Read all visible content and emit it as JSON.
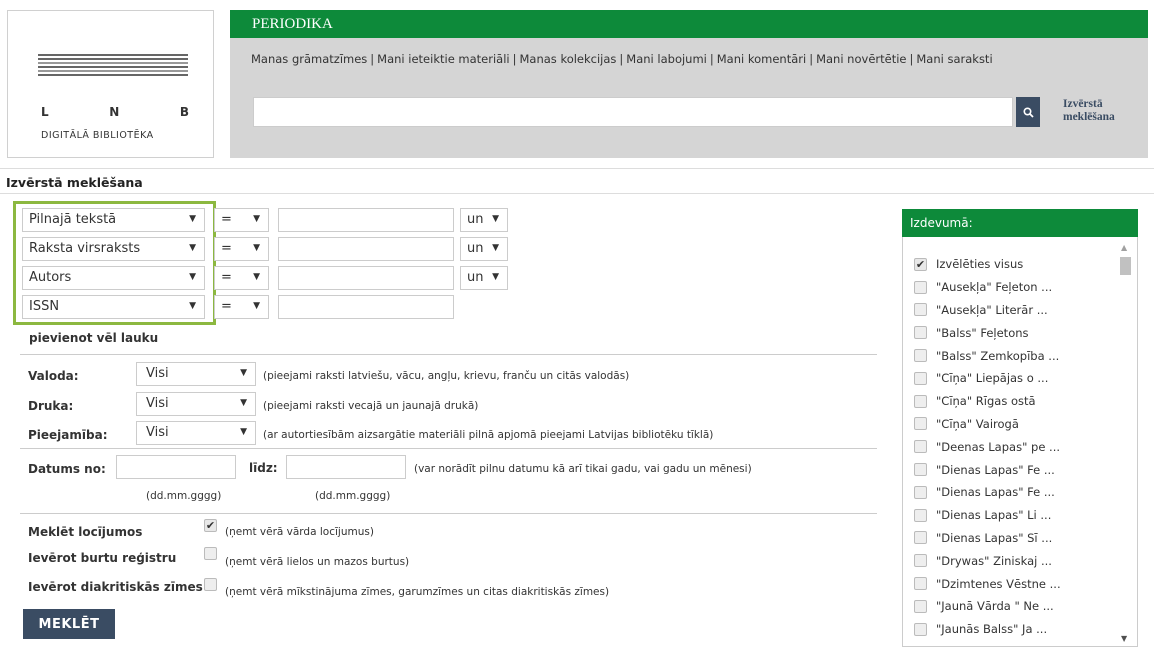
{
  "logo": {
    "letters": [
      "L",
      "N",
      "B"
    ],
    "subtitle": "DIGITĀLĀ BIBLIOTĒKA"
  },
  "header": {
    "title": "PERIODIKA",
    "links": [
      "Manas grāmatzīmes",
      "Mani ieteiktie materiāli",
      "Manas kolekcijas",
      "Mani labojumi",
      "Mani komentāri",
      "Mani novērtētie",
      "Mani saraksti"
    ],
    "search_icon": "search-icon",
    "advanced_line1": "Izvērstā",
    "advanced_line2": "meklēšana"
  },
  "page_title": "Izvērstā meklēšana",
  "fields": [
    {
      "field": "Pilnajā tekstā",
      "op": "=",
      "value": "",
      "conj": "un"
    },
    {
      "field": "Raksta virsraksts",
      "op": "=",
      "value": "",
      "conj": "un"
    },
    {
      "field": "Autors",
      "op": "=",
      "value": "",
      "conj": "un"
    },
    {
      "field": "ISSN",
      "op": "=",
      "value": "",
      "conj": ""
    }
  ],
  "add_field": "pievienot vēl lauku",
  "filters": [
    {
      "label": "Valoda:",
      "value": "Visi",
      "note": "(pieejami raksti latviešu, vācu, angļu, krievu, franču un citās valodās)"
    },
    {
      "label": "Druka:",
      "value": "Visi",
      "note": "(pieejami raksti vecajā un jaunajā drukā)"
    },
    {
      "label": "Pieejamība:",
      "value": "Visi",
      "note": "(ar autortiesībām aizsargātie materiāli pilnā apjomā pieejami Latvijas bibliotēku tīklā)"
    }
  ],
  "dates": {
    "from_label": "Datums no:",
    "to_label": "līdz:",
    "note": "(var norādīt pilnu datumu kā arī tikai gadu, vai gadu un mēnesi)",
    "format_from": "(dd.mm.gggg)",
    "format_to": "(dd.mm.gggg)"
  },
  "options": [
    {
      "label": "Meklēt locījumos",
      "checked": true,
      "note": "(ņemt vērā vārda locījumus)"
    },
    {
      "label": "Ievērot burtu reģistru",
      "checked": false,
      "note": "(ņemt vērā lielos un mazos burtus)"
    },
    {
      "label": "Ievērot diakritiskās zīmes",
      "checked": false,
      "note": "(ņemt vērā mīkstinājuma zīmes, garumzīmes un citas diakritiskās zīmes)"
    }
  ],
  "submit_label": "MEKLĒT",
  "publications": {
    "title": "Izdevumā:",
    "items": [
      {
        "label": "Izvēlēties visus",
        "checked": true
      },
      {
        "label": "\"Ausekļa\" Feļeton ...",
        "checked": false
      },
      {
        "label": "\"Ausekļa\" Literār ...",
        "checked": false
      },
      {
        "label": "\"Balss\" Feļetons",
        "checked": false
      },
      {
        "label": "\"Balss\" Zemkopība ...",
        "checked": false
      },
      {
        "label": "\"Cīņa\" Liepājas o ...",
        "checked": false
      },
      {
        "label": "\"Cīņa\" Rīgas ostā",
        "checked": false
      },
      {
        "label": "\"Cīņa\" Vairogā",
        "checked": false
      },
      {
        "label": "\"Deenas Lapas\" pe ...",
        "checked": false
      },
      {
        "label": "\"Dienas Lapas\" Fe ...",
        "checked": false
      },
      {
        "label": "\"Dienas Lapas\" Fe ...",
        "checked": false
      },
      {
        "label": "\"Dienas Lapas\" Li ...",
        "checked": false
      },
      {
        "label": "\"Dienas Lapas\" Sī ...",
        "checked": false
      },
      {
        "label": "\"Drywas\" Ziniskaj ...",
        "checked": false
      },
      {
        "label": "\"Dzimtenes Vēstne ...",
        "checked": false
      },
      {
        "label": "\"Jaunā Vārda \" Ne ...",
        "checked": false
      },
      {
        "label": "\"Jaunās Balss\" Ja ...",
        "checked": false
      }
    ]
  }
}
